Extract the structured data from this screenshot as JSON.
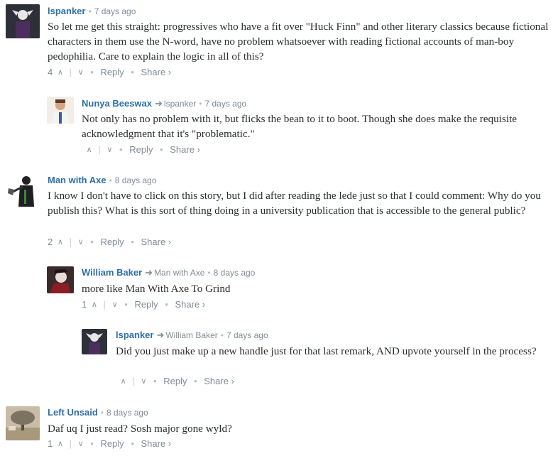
{
  "comments": [
    {
      "author": "lspanker",
      "time": "7 days ago",
      "text": "So let me get this straight: progressives who have a fit over \"Huck Finn\" and other literary classics because fictional characters in them use the N-word, have no problem whatsoever with reading fictional accounts of man-boy pedophilia. Care to explain the logic in all of this?",
      "upvotes": "4",
      "reply_label": "Reply",
      "share_label": "Share ›"
    },
    {
      "author": "Nunya Beeswax",
      "reply_to": "lspanker",
      "time": "7 days ago",
      "text": "Not only has no problem with it, but flicks the bean to it to boot. Though she does make the requisite acknowledgment that it's \"problematic.\"",
      "upvotes": "",
      "reply_label": "Reply",
      "share_label": "Share ›"
    },
    {
      "author": "Man with Axe",
      "time": "8 days ago",
      "text": "I know I don't have to click on this story, but I did after reading the lede just so that I could comment: Why do you publish this? What is this sort of thing doing in a university publication that is accessible to the general public?",
      "upvotes": "2",
      "reply_label": "Reply",
      "share_label": "Share ›"
    },
    {
      "author": "William Baker",
      "reply_to": "Man with Axe",
      "time": "8 days ago",
      "text": "more like Man With Axe To Grind",
      "upvotes": "1",
      "reply_label": "Reply",
      "share_label": "Share ›"
    },
    {
      "author": "lspanker",
      "reply_to": "William Baker",
      "time": "7 days ago",
      "text": "Did you just make up a new handle just for that last remark, AND upvote yourself in the process?",
      "upvotes": "",
      "reply_label": "Reply",
      "share_label": "Share ›"
    },
    {
      "author": "Left Unsaid",
      "time": "8 days ago",
      "text": "Daf uq I just read? Sosh major gone wyld?",
      "upvotes": "1",
      "reply_label": "Reply",
      "share_label": "Share ›"
    }
  ],
  "icons": {
    "upvote": "chevron-up-icon",
    "downvote": "chevron-down-icon",
    "reply_arrow": "reply-arrow-icon"
  },
  "colors": {
    "author": "#2e6fa7",
    "meta": "#7f8b95",
    "text": "#2a2e2e"
  }
}
